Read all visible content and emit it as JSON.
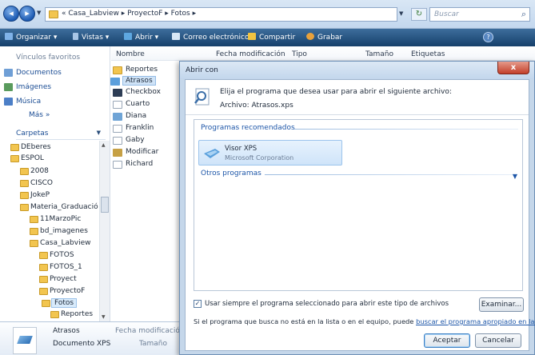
{
  "address_bar": {
    "path_prefix": "«",
    "path": "Casa_Labview ▸ ProyectoF ▸ Fotos ▸",
    "search_placeholder": "Buscar"
  },
  "command_bar": {
    "organizar": "Organizar ▾",
    "vistas": "Vistas ▾",
    "abrir": "Abrir ▾",
    "correo": "Correo electrónico",
    "compartir": "Compartir",
    "grabar": "Grabar"
  },
  "nav_pane": {
    "favorites_header": "Vínculos favoritos",
    "favorites": [
      "Documentos",
      "Imágenes",
      "Música"
    ],
    "more": "Más »",
    "folders_header": "Carpetas",
    "tree": [
      "DEberes",
      "ESPOL",
      "2008",
      "CISCO",
      "JokeP",
      "Materia_Graduació",
      "11MarzoPic",
      "bd_imagenes",
      "Casa_Labview",
      "FOTOS",
      "FOTOS_1",
      "Proyect",
      "ProyectoF",
      "Fotos",
      "Reportes"
    ]
  },
  "file_list": {
    "columns": [
      "Nombre",
      "Fecha modificación",
      "Tipo",
      "Tamaño",
      "Etiquetas"
    ],
    "files": [
      "Reportes",
      "Atrasos",
      "Checkbox",
      "Cuarto",
      "Diana",
      "Franklin",
      "Gaby",
      "Modificar",
      "Richard"
    ]
  },
  "details": {
    "name": "Atrasos",
    "type": "Documento XPS",
    "label_date": "Fecha modificación",
    "label_size": "Tamaño"
  },
  "dialog": {
    "title": "Abrir con",
    "close": "x",
    "instruction": "Elija el programa que desea usar para abrir el siguiente archivo:",
    "file_label": "Archivo:  Atrasos.xps",
    "recommended_header": "Programas recomendados",
    "program_name": "Visor XPS",
    "program_publisher": "Microsoft Corporation",
    "other_header": "Otros programas",
    "always_use_label": "Usar siempre el programa seleccionado para abrir este tipo de archivos",
    "always_use_checked": true,
    "examinar": "Examinar...",
    "hint_text": "Si el programa que busca no está en la lista o en el equipo, puede",
    "hint_link": "buscar el programa apropiado en la Web.",
    "ok": "Aceptar",
    "cancel": "Cancelar"
  },
  "colors": {
    "cmdbar": "#16406b",
    "link": "#1d56a8",
    "selection": "#cfe3f7"
  }
}
